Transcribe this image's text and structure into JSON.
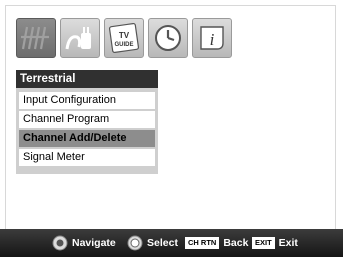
{
  "tabs": [
    {
      "icon": "antenna-icon",
      "active": true
    },
    {
      "icon": "plug-icon",
      "active": false
    },
    {
      "icon": "tv-guide-icon",
      "active": false,
      "text_line1": "TV",
      "text_line2": "GUIDE"
    },
    {
      "icon": "clock-icon",
      "active": false
    },
    {
      "icon": "info-icon",
      "active": false,
      "text": "i"
    }
  ],
  "menu": {
    "title": "Terrestrial",
    "items": [
      {
        "label": "Input Configuration",
        "selected": false
      },
      {
        "label": "Channel Program",
        "selected": false
      },
      {
        "label": "Channel Add/Delete",
        "selected": true
      },
      {
        "label": "Signal Meter",
        "selected": false
      }
    ]
  },
  "footer": {
    "navigate_label": "Navigate",
    "select_label": "Select",
    "ch_rtn_key": "CH RTN",
    "back_label": "Back",
    "exit_key": "EXIT",
    "exit_label": "Exit"
  },
  "colors": {
    "menu_title_bg": "#303030",
    "selected_item_bg": "#8d8d8d",
    "bottom_bar_bg": "#1f1f1f"
  }
}
